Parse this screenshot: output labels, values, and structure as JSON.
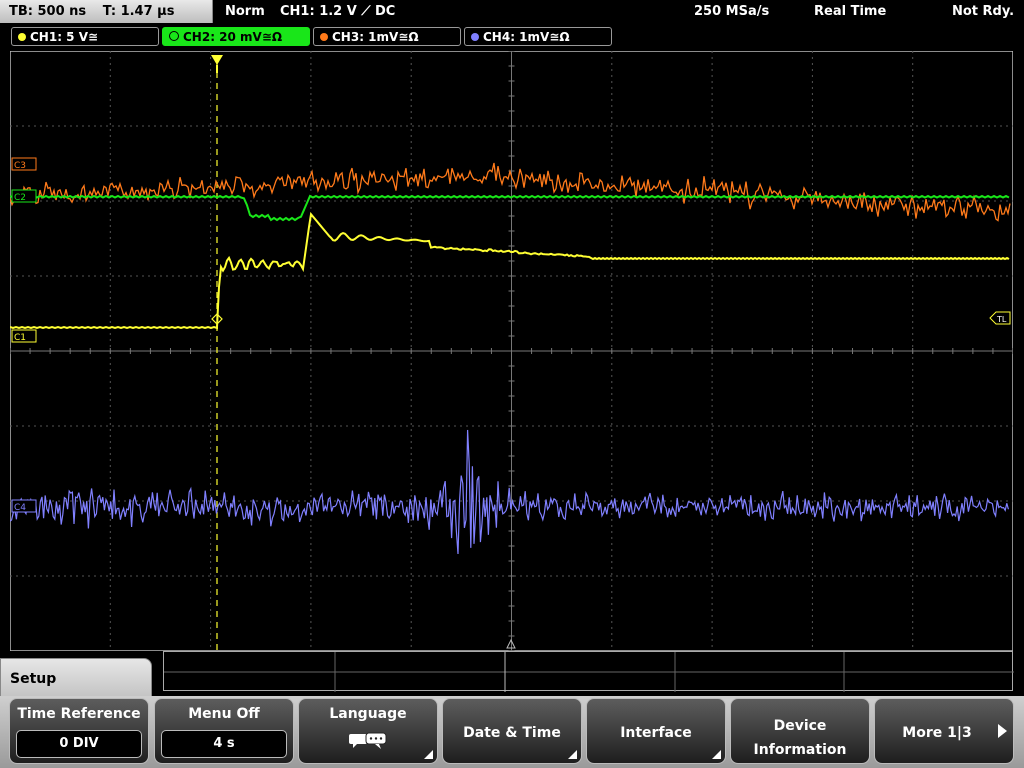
{
  "status": {
    "timebase": "TB: 500 ns",
    "trigger_time": "T: 1.47 µs",
    "mode": "Norm",
    "trigger": "CH1: 1.2 V ⟋ DC",
    "sample_rate": "250 MSa/s",
    "acq_mode": "Real Time",
    "state": "Not Rdy."
  },
  "channels": [
    {
      "label": "CH1: 5 V≅",
      "color": "#ffff33"
    },
    {
      "label": "CH2: 20 mV≅Ω",
      "color": "#19e619"
    },
    {
      "label": "CH3: 1mV≅Ω",
      "color": "#ff7a1a"
    },
    {
      "label": "CH4: 1mV≅Ω",
      "color": "#8080ff"
    }
  ],
  "markers": {
    "c1": "C1",
    "c3": "C3",
    "c2": "C2",
    "c4": "C4",
    "trigger_level": "TL"
  },
  "menu": {
    "title": "Setup",
    "items": [
      {
        "title": "Time Reference",
        "value": "0 DIV"
      },
      {
        "title": "Menu Off",
        "value": "4 s"
      },
      {
        "title": "Language",
        "icon": "speech-bubbles-icon"
      },
      {
        "title": "Date & Time"
      },
      {
        "title": "Interface"
      },
      {
        "title_line1": "Device",
        "title_line2": "Information"
      },
      {
        "title": "More 1|3"
      }
    ]
  }
}
